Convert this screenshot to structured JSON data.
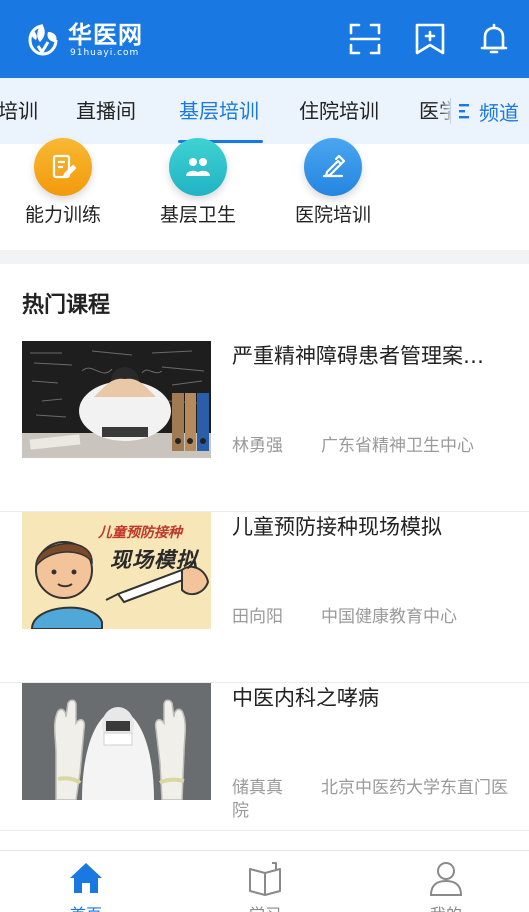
{
  "header": {
    "logo_cn": "华医网",
    "logo_en": "91huayi.com",
    "icons": [
      "scan-icon",
      "bookmark-add-icon",
      "bell-icon"
    ]
  },
  "tabs": {
    "items": [
      "培训",
      "直播间",
      "基层培训",
      "住院培训",
      "医学"
    ],
    "active": "基层培训",
    "channel_label": "频道"
  },
  "categories": [
    {
      "label": "能力训练",
      "icon": "document-edit-icon",
      "color": "#f5a31a"
    },
    {
      "label": "基层卫生",
      "icon": "group-icon",
      "color": "#2bc4c6"
    },
    {
      "label": "医院培训",
      "icon": "hand-pen-icon",
      "color": "#2f95e8"
    }
  ],
  "hot_courses": {
    "title": "热门课程",
    "items": [
      {
        "title": "严重精神障碍患者管理案…",
        "author": "林勇强",
        "org": "广东省精神卫生中心"
      },
      {
        "title": "儿童预防接种现场模拟",
        "author": "田向阳",
        "org": "中国健康教育中心",
        "thumb_text_1": "儿童预防接种",
        "thumb_text_2": "现场模拟"
      },
      {
        "title": "中医内科之哮病",
        "author": "储真真院",
        "org": "北京中医药大学东直门医"
      }
    ]
  },
  "bottom_nav": [
    {
      "label": "首页",
      "icon": "home-icon",
      "active": true
    },
    {
      "label": "学习",
      "icon": "book-icon",
      "active": false
    },
    {
      "label": "我的",
      "icon": "person-icon",
      "active": false
    }
  ],
  "colors": {
    "brand_blue": "#1a78e3",
    "tab_bg": "#ebf4fd",
    "muted_text": "#9a9a9a"
  }
}
